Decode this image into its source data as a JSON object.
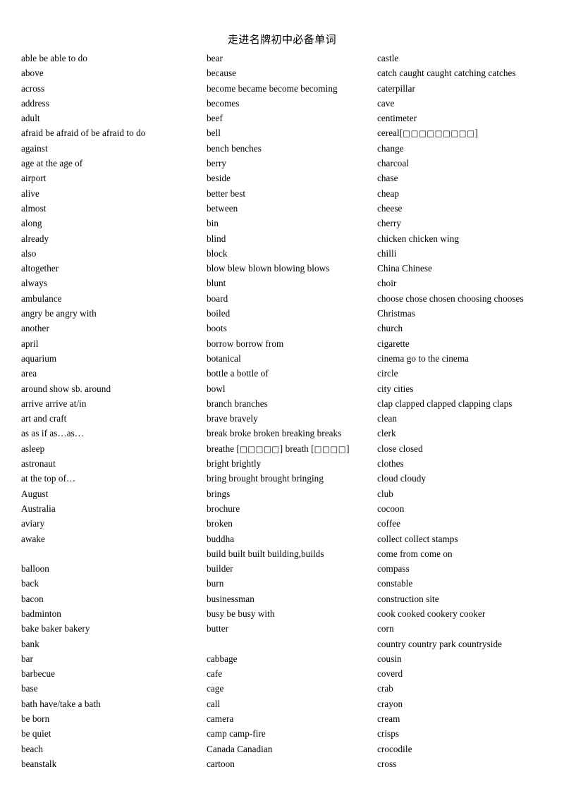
{
  "document": {
    "title": "走进名牌初中必备单词",
    "background_color": "#ffffff",
    "text_color": "#000000",
    "column_count": 3
  },
  "columns": [
    {
      "name": "column-1",
      "entries": [
        "able   be able to do",
        "above",
        "across",
        "address",
        "adult",
        "afraid   be afraid of   be afraid to do",
        "against",
        "age   at the age of",
        "airport",
        "alive",
        "almost",
        "along",
        "already",
        "also",
        "altogether",
        "always",
        "ambulance",
        "angry   be angry with",
        "another",
        "april",
        "aquarium",
        "area",
        "around   show sb. around",
        "arrive   arrive at/in",
        "art and craft",
        "as   as if   as…as…",
        "asleep",
        "astronaut",
        "at the top of…",
        "August",
        "Australia",
        "aviary",
        "awake",
        "",
        "balloon",
        "back",
        "bacon",
        "badminton",
        "bake   baker   bakery",
        "bank",
        "bar",
        "barbecue",
        "base",
        "bath   have/take a bath",
        "be born",
        "be quiet",
        "beach",
        "beanstalk"
      ]
    },
    {
      "name": "column-2",
      "entries": [
        "bear",
        "because",
        "become   became become becoming",
        "becomes",
        "beef",
        "bell",
        "bench   benches",
        "berry",
        "beside",
        "better   best",
        "between",
        "bin",
        "blind",
        "block",
        "blow   blew blown blowing blows",
        "blunt",
        "board",
        "boiled",
        "boots",
        "borrow   borrow from",
        "botanical",
        "bottle   a bottle of",
        "bowl",
        "branch   branches",
        "brave   bravely",
        "break   broke broken breaking breaks",
        "breathe [□□□□□]   breath [□□□□]",
        "bright   brightly",
        "bring   brought brought bringing",
        "brings",
        "brochure",
        "broken",
        "buddha",
        "build   built built building,builds",
        "builder",
        "burn",
        "businessman",
        "busy   be busy with",
        "butter",
        "",
        "cabbage",
        "cafe",
        "cage",
        "call",
        "camera",
        "camp   camp-fire",
        "Canada   Canadian",
        "cartoon"
      ]
    },
    {
      "name": "column-3",
      "entries": [
        "castle",
        "catch   caught caught catching catches",
        "caterpillar",
        "cave",
        "centimeter",
        "cereal[□□□□□□□□□]",
        "change",
        "charcoal",
        "chase",
        "cheap",
        "cheese",
        "cherry",
        "chicken   chicken wing",
        "chilli",
        "China   Chinese",
        "choir",
        "choose   chose chosen choosing chooses",
        "Christmas",
        "church",
        "cigarette",
        "cinema   go to the cinema",
        "circle",
        "city   cities",
        "clap   clapped clapped clapping claps",
        "clean",
        "clerk",
        "close   closed",
        "clothes",
        "cloud   cloudy",
        "club",
        "cocoon",
        "coffee",
        "collect   collect stamps",
        "come from   come on",
        "compass",
        "constable",
        "construction site",
        "cook   cooked cookery cooker",
        "corn",
        "country   country park   countryside",
        "cousin",
        "coverd",
        "crab",
        "crayon",
        "cream",
        "crisps",
        "crocodile",
        "cross"
      ]
    }
  ]
}
